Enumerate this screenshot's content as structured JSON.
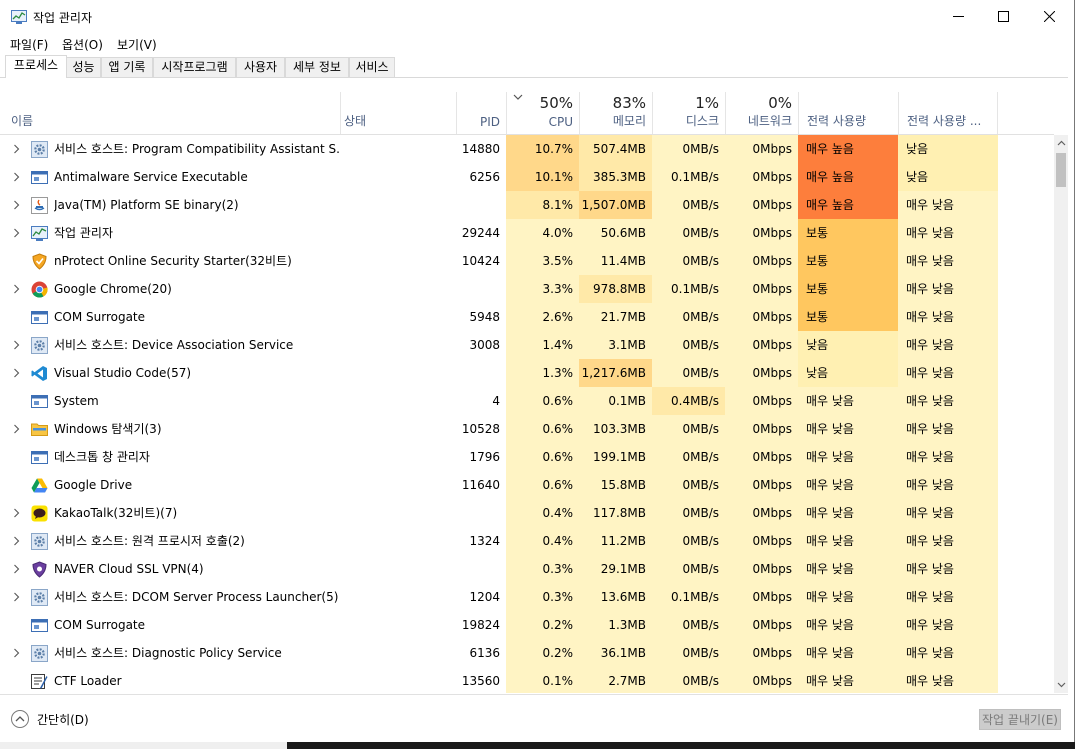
{
  "window": {
    "title": "작업 관리자"
  },
  "menu": [
    "파일(F)",
    "옵션(O)",
    "보기(V)"
  ],
  "tabs": [
    {
      "label": "프로세스",
      "active": true
    },
    {
      "label": "성능",
      "active": false
    },
    {
      "label": "앱 기록",
      "active": false
    },
    {
      "label": "시작프로그램",
      "active": false
    },
    {
      "label": "사용자",
      "active": false
    },
    {
      "label": "세부 정보",
      "active": false
    },
    {
      "label": "서비스",
      "active": false
    }
  ],
  "columns": {
    "name": "이름",
    "status": "상태",
    "pid": "PID",
    "cpu": {
      "pct": "50%",
      "label": "CPU"
    },
    "memory": {
      "pct": "83%",
      "label": "메모리"
    },
    "disk": {
      "pct": "1%",
      "label": "디스크"
    },
    "network": {
      "pct": "0%",
      "label": "네트워크"
    },
    "power": "전력 사용량",
    "power_trend": "전력 사용량 ..."
  },
  "colors": {
    "heat_low": "#fff4c4",
    "heat_mid": "#ffe9a8",
    "heat_high": "#ffd88a",
    "power_very_high": "#fd7e3c",
    "power_medium": "#ffc75f",
    "power_low": "#fff0b2",
    "power_very_low": "#fff4c4"
  },
  "processes": [
    {
      "expandable": true,
      "icon": "service-gear-icon",
      "name": "서비스 호스트: Program Compatibility Assistant S...",
      "pid": "14880",
      "cpu": "10.7%",
      "memory": "507.4MB",
      "disk": "0MB/s",
      "network": "0Mbps",
      "power": "매우 높음",
      "power_trend": "낮음",
      "cpu_heat": "high",
      "mem_heat": "mid",
      "disk_heat": "low",
      "power_level": "very_high",
      "trend_level": "low"
    },
    {
      "expandable": true,
      "icon": "window-app-icon",
      "name": "Antimalware Service Executable",
      "pid": "6256",
      "cpu": "10.1%",
      "memory": "385.3MB",
      "disk": "0.1MB/s",
      "network": "0Mbps",
      "power": "매우 높음",
      "power_trend": "낮음",
      "cpu_heat": "high",
      "mem_heat": "mid",
      "disk_heat": "low",
      "power_level": "very_high",
      "trend_level": "low"
    },
    {
      "expandable": true,
      "icon": "java-icon",
      "name": "Java(TM) Platform SE binary(2)",
      "pid": "",
      "cpu": "8.1%",
      "memory": "1,507.0MB",
      "disk": "0MB/s",
      "network": "0Mbps",
      "power": "매우 높음",
      "power_trend": "매우 낮음",
      "cpu_heat": "mid",
      "mem_heat": "high",
      "disk_heat": "low",
      "power_level": "very_high",
      "trend_level": "very_low"
    },
    {
      "expandable": true,
      "icon": "task-manager-icon",
      "name": "작업 관리자",
      "pid": "29244",
      "cpu": "4.0%",
      "memory": "50.6MB",
      "disk": "0MB/s",
      "network": "0Mbps",
      "power": "보통",
      "power_trend": "매우 낮음",
      "cpu_heat": "low",
      "mem_heat": "low",
      "disk_heat": "low",
      "power_level": "medium",
      "trend_level": "very_low"
    },
    {
      "expandable": false,
      "icon": "shield-icon",
      "name": "nProtect Online Security Starter(32비트)",
      "pid": "10424",
      "cpu": "3.5%",
      "memory": "11.4MB",
      "disk": "0MB/s",
      "network": "0Mbps",
      "power": "보통",
      "power_trend": "매우 낮음",
      "cpu_heat": "low",
      "mem_heat": "low",
      "disk_heat": "low",
      "power_level": "medium",
      "trend_level": "very_low"
    },
    {
      "expandable": true,
      "icon": "chrome-icon",
      "name": "Google Chrome(20)",
      "pid": "",
      "cpu": "3.3%",
      "memory": "978.8MB",
      "disk": "0.1MB/s",
      "network": "0Mbps",
      "power": "보통",
      "power_trend": "매우 낮음",
      "cpu_heat": "low",
      "mem_heat": "mid",
      "disk_heat": "low",
      "power_level": "medium",
      "trend_level": "very_low"
    },
    {
      "expandable": false,
      "icon": "window-app-icon",
      "name": "COM Surrogate",
      "pid": "5948",
      "cpu": "2.6%",
      "memory": "21.7MB",
      "disk": "0MB/s",
      "network": "0Mbps",
      "power": "보통",
      "power_trend": "매우 낮음",
      "cpu_heat": "low",
      "mem_heat": "low",
      "disk_heat": "low",
      "power_level": "medium",
      "trend_level": "very_low"
    },
    {
      "expandable": true,
      "icon": "service-gear-icon",
      "name": "서비스 호스트: Device Association Service",
      "pid": "3008",
      "cpu": "1.4%",
      "memory": "3.1MB",
      "disk": "0MB/s",
      "network": "0Mbps",
      "power": "낮음",
      "power_trend": "매우 낮음",
      "cpu_heat": "low",
      "mem_heat": "low",
      "disk_heat": "low",
      "power_level": "low",
      "trend_level": "very_low"
    },
    {
      "expandable": true,
      "icon": "vscode-icon",
      "name": "Visual Studio Code(57)",
      "pid": "",
      "cpu": "1.3%",
      "memory": "1,217.6MB",
      "disk": "0MB/s",
      "network": "0Mbps",
      "power": "낮음",
      "power_trend": "매우 낮음",
      "cpu_heat": "low",
      "mem_heat": "high",
      "disk_heat": "low",
      "power_level": "low",
      "trend_level": "very_low"
    },
    {
      "expandable": false,
      "icon": "window-app-icon",
      "name": "System",
      "pid": "4",
      "cpu": "0.6%",
      "memory": "0.1MB",
      "disk": "0.4MB/s",
      "network": "0Mbps",
      "power": "매우 낮음",
      "power_trend": "매우 낮음",
      "cpu_heat": "low",
      "mem_heat": "low",
      "disk_heat": "mid",
      "power_level": "very_low",
      "trend_level": "very_low"
    },
    {
      "expandable": true,
      "icon": "folder-icon",
      "name": "Windows 탐색기(3)",
      "pid": "10528",
      "cpu": "0.6%",
      "memory": "103.3MB",
      "disk": "0MB/s",
      "network": "0Mbps",
      "power": "매우 낮음",
      "power_trend": "매우 낮음",
      "cpu_heat": "low",
      "mem_heat": "low",
      "disk_heat": "low",
      "power_level": "very_low",
      "trend_level": "very_low"
    },
    {
      "expandable": false,
      "icon": "window-app-icon",
      "name": "데스크톱 창 관리자",
      "pid": "1796",
      "cpu": "0.6%",
      "memory": "199.1MB",
      "disk": "0MB/s",
      "network": "0Mbps",
      "power": "매우 낮음",
      "power_trend": "매우 낮음",
      "cpu_heat": "low",
      "mem_heat": "low",
      "disk_heat": "low",
      "power_level": "very_low",
      "trend_level": "very_low"
    },
    {
      "expandable": false,
      "icon": "google-drive-icon",
      "name": "Google Drive",
      "pid": "11640",
      "cpu": "0.6%",
      "memory": "15.8MB",
      "disk": "0MB/s",
      "network": "0Mbps",
      "power": "매우 낮음",
      "power_trend": "매우 낮음",
      "cpu_heat": "low",
      "mem_heat": "low",
      "disk_heat": "low",
      "power_level": "very_low",
      "trend_level": "very_low"
    },
    {
      "expandable": true,
      "icon": "kakaotalk-icon",
      "name": "KakaoTalk(32비트)(7)",
      "pid": "",
      "cpu": "0.4%",
      "memory": "117.8MB",
      "disk": "0MB/s",
      "network": "0Mbps",
      "power": "매우 낮음",
      "power_trend": "매우 낮음",
      "cpu_heat": "low",
      "mem_heat": "low",
      "disk_heat": "low",
      "power_level": "very_low",
      "trend_level": "very_low"
    },
    {
      "expandable": true,
      "icon": "service-gear-icon",
      "name": "서비스 호스트: 원격 프로시저 호출(2)",
      "pid": "1324",
      "cpu": "0.4%",
      "memory": "11.2MB",
      "disk": "0MB/s",
      "network": "0Mbps",
      "power": "매우 낮음",
      "power_trend": "매우 낮음",
      "cpu_heat": "low",
      "mem_heat": "low",
      "disk_heat": "low",
      "power_level": "very_low",
      "trend_level": "very_low"
    },
    {
      "expandable": true,
      "icon": "vpn-shield-icon",
      "name": "NAVER Cloud SSL VPN(4)",
      "pid": "",
      "cpu": "0.3%",
      "memory": "29.1MB",
      "disk": "0MB/s",
      "network": "0Mbps",
      "power": "매우 낮음",
      "power_trend": "매우 낮음",
      "cpu_heat": "low",
      "mem_heat": "low",
      "disk_heat": "low",
      "power_level": "very_low",
      "trend_level": "very_low"
    },
    {
      "expandable": true,
      "icon": "service-gear-icon",
      "name": "서비스 호스트: DCOM Server Process Launcher(5)",
      "pid": "1204",
      "cpu": "0.3%",
      "memory": "13.6MB",
      "disk": "0.1MB/s",
      "network": "0Mbps",
      "power": "매우 낮음",
      "power_trend": "매우 낮음",
      "cpu_heat": "low",
      "mem_heat": "low",
      "disk_heat": "low",
      "power_level": "very_low",
      "trend_level": "very_low"
    },
    {
      "expandable": false,
      "icon": "window-app-icon",
      "name": "COM Surrogate",
      "pid": "19824",
      "cpu": "0.2%",
      "memory": "1.3MB",
      "disk": "0MB/s",
      "network": "0Mbps",
      "power": "매우 낮음",
      "power_trend": "매우 낮음",
      "cpu_heat": "low",
      "mem_heat": "low",
      "disk_heat": "low",
      "power_level": "very_low",
      "trend_level": "very_low"
    },
    {
      "expandable": true,
      "icon": "service-gear-icon",
      "name": "서비스 호스트: Diagnostic Policy Service",
      "pid": "6136",
      "cpu": "0.2%",
      "memory": "36.1MB",
      "disk": "0MB/s",
      "network": "0Mbps",
      "power": "매우 낮음",
      "power_trend": "매우 낮음",
      "cpu_heat": "low",
      "mem_heat": "low",
      "disk_heat": "low",
      "power_level": "very_low",
      "trend_level": "very_low"
    },
    {
      "expandable": false,
      "icon": "ctf-loader-icon",
      "name": "CTF Loader",
      "pid": "13560",
      "cpu": "0.1%",
      "memory": "2.7MB",
      "disk": "0MB/s",
      "network": "0Mbps",
      "power": "매우 낮음",
      "power_trend": "매우 낮음",
      "cpu_heat": "low",
      "mem_heat": "low",
      "disk_heat": "low",
      "power_level": "very_low",
      "trend_level": "very_low"
    }
  ],
  "footer": {
    "fewer_details": "간단히(D)",
    "end_task": "작업 끝내기(E)"
  }
}
